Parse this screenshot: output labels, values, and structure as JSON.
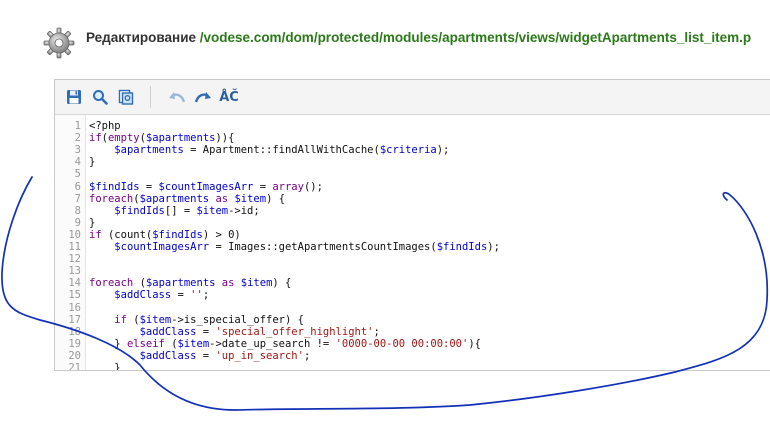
{
  "header": {
    "label": "Редактирование",
    "path": "/vodese.com/dom/protected/modules/apartments/views/widgetApartments_list_item.p"
  },
  "icons": {
    "settings": "gear-icon",
    "save": "floppy-disk-icon",
    "search": "magnifier-icon",
    "replace": "find-replace-icon",
    "undo": "undo-arrow-icon",
    "redo": "redo-arrow-icon",
    "highlight": "syntax-toggle-icon"
  },
  "toolbar": {
    "syntax_label": "ÅČ"
  },
  "colors": {
    "keyword": "#7a0088",
    "variable": "#0000cc",
    "string": "#a31515",
    "path_link": "#2a7a18",
    "scribble": "#1230b8"
  },
  "code_lines": [
    {
      "n": "1",
      "html": "&lt;?php"
    },
    {
      "n": "2",
      "html": "<span class=\"k\">if</span>(<span class=\"k\">empty</span>(<span class=\"v\">$apartments</span>)){"
    },
    {
      "n": "3",
      "html": "    <span class=\"v\">$apartments</span> = Apartment::findAllWithCache(<span class=\"v\">$criteria</span>);"
    },
    {
      "n": "4",
      "html": "}"
    },
    {
      "n": "5",
      "html": ""
    },
    {
      "n": "6",
      "html": "<span class=\"v\">$findIds</span> = <span class=\"v\">$countImagesArr</span> = <span class=\"k\">array</span>();"
    },
    {
      "n": "7",
      "html": "<span class=\"k\">foreach</span>(<span class=\"v\">$apartments</span> <span class=\"k\">as</span> <span class=\"v\">$item</span>) {"
    },
    {
      "n": "8",
      "html": "    <span class=\"v\">$findIds</span>[] = <span class=\"v\">$item</span>-&gt;id;"
    },
    {
      "n": "9",
      "html": "}"
    },
    {
      "n": "10",
      "html": "<span class=\"k\">if</span> (count(<span class=\"v\">$findIds</span>) &gt; 0)"
    },
    {
      "n": "11",
      "html": "    <span class=\"v\">$countImagesArr</span> = Images::getApartmentsCountImages(<span class=\"v\">$findIds</span>);"
    },
    {
      "n": "12",
      "html": ""
    },
    {
      "n": "13",
      "html": ""
    },
    {
      "n": "14",
      "html": "<span class=\"k\">foreach</span> (<span class=\"v\">$apartments</span> <span class=\"k\">as</span> <span class=\"v\">$item</span>) {"
    },
    {
      "n": "15",
      "html": "    <span class=\"v\">$addClass</span> = <span class=\"s\">''</span>;"
    },
    {
      "n": "16",
      "html": ""
    },
    {
      "n": "17",
      "html": "    <span class=\"k\">if</span> (<span class=\"v\">$item</span>-&gt;is_special_offer) {"
    },
    {
      "n": "18",
      "html": "        <span class=\"v\">$addClass</span> = <span class=\"s\">'special_offer_highlight'</span>;"
    },
    {
      "n": "19",
      "html": "    } <span class=\"k\">elseif</span> (<span class=\"v\">$item</span>-&gt;date_up_search != <span class=\"s\">'0000-00-00 00:00:00'</span>){"
    },
    {
      "n": "20",
      "html": "        <span class=\"v\">$addClass</span> = <span class=\"s\">'up_in_search'</span>;"
    },
    {
      "n": "21",
      "html": "    }"
    }
  ]
}
